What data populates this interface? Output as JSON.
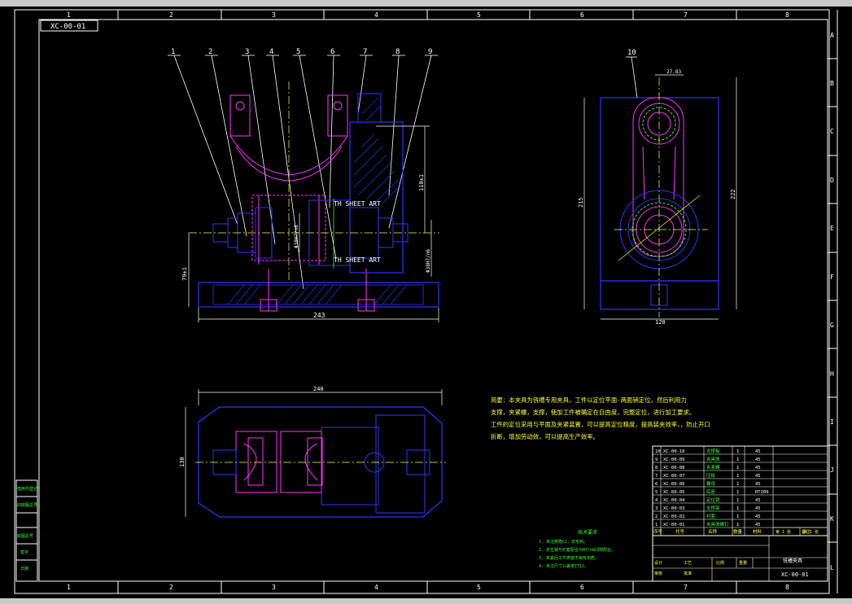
{
  "drawing": {
    "code_box": "XC-00-01",
    "border_columns": [
      "1",
      "2",
      "3",
      "4",
      "5",
      "6",
      "7",
      "8"
    ],
    "border_rows": [
      "A",
      "B",
      "C",
      "D",
      "E",
      "F",
      "G",
      "H",
      "I",
      "J",
      "K",
      "L"
    ],
    "front_view": {
      "balloons": [
        "1",
        "2",
        "3",
        "4",
        "5",
        "6",
        "7",
        "8",
        "9"
      ],
      "dim_width": "243",
      "dim_height_left": "79±1",
      "dim_right_vertical": "110±1",
      "dim_bore_1": "Φ38H7/n6",
      "dim_bore_2": "Φ38H7/n6",
      "callout_1": "TH SHEET ART",
      "callout_2": "TH SHEET ART"
    },
    "side_view": {
      "balloons": [
        "10"
      ],
      "dim_top": "27.83",
      "dim_left_vertical": "215",
      "dim_right_vertical": "222",
      "dim_width": "120"
    },
    "top_view": {
      "dim_width": "240",
      "dim_height": "130"
    },
    "notes": {
      "lines": [
        "简要：本夹具为铣槽专用夹具，工件以定位平面-两面销定位，然后利用力",
        "支撑，夹紧螺，支撑，使加工件被确定在自由度，完整定位，进行加工要求。",
        "工件的定位采用与平面及夹紧装置，可以提高定位精度，提高装夹效率，，防止开口",
        "折断，增加劳动效，可以提高生产效率。"
      ]
    },
    "tech_requirements": {
      "title": "技术要求",
      "items": [
        "1. 未注倒角C1，去毛刺。",
        "2. 定位销与衬套配合为H7/n6间隙配合。",
        "3. 夹紧后工件表面不得有划痕。",
        "4. 未注尺寸公差按IT12。"
      ]
    },
    "left_side_labels": [
      "借用件登记",
      "旧底图总号",
      "底图总号",
      "签字",
      "日期"
    ],
    "bom": {
      "rows": [
        {
          "no": "10",
          "code": "XC-00-10",
          "name": "支撑板",
          "qty": "1",
          "mat": "45"
        },
        {
          "no": "9",
          "code": "XC-00-09",
          "name": "夹具体",
          "qty": "1",
          "mat": "45"
        },
        {
          "no": "8",
          "code": "XC-00-08",
          "name": "夹紧螺",
          "qty": "1",
          "mat": "45"
        },
        {
          "no": "7",
          "code": "XC-00-07",
          "name": "压板",
          "qty": "1",
          "mat": "45"
        },
        {
          "no": "6",
          "code": "XC-00-06",
          "name": "螺母",
          "qty": "1",
          "mat": "45"
        },
        {
          "no": "5",
          "code": "XC-00-05",
          "name": "底座",
          "qty": "1",
          "mat": "HT200"
        },
        {
          "no": "4",
          "code": "XC-00-04",
          "name": "定位销",
          "qty": "1",
          "mat": "45"
        },
        {
          "no": "3",
          "code": "XC-00-03",
          "name": "支撑架",
          "qty": "1",
          "mat": "45"
        },
        {
          "no": "2",
          "code": "XC-00-02",
          "name": "衬套",
          "qty": "1",
          "mat": "45"
        },
        {
          "no": "1",
          "code": "XC-00-01",
          "name": "夹具体螺钉",
          "qty": "1",
          "mat": "45"
        }
      ],
      "header": [
        "序号",
        "代号",
        "名称",
        "数量",
        "材料",
        "备注"
      ],
      "sheet_no": [
        "第 1 张",
        "共 1 张"
      ]
    },
    "title_block": {
      "drawing_name": "铣槽夹具",
      "drawing_code": "XC-00-01",
      "labels": [
        "设计",
        "审核",
        "工艺",
        "批准"
      ],
      "scale_label": "比例",
      "weight_label": "重量"
    }
  }
}
